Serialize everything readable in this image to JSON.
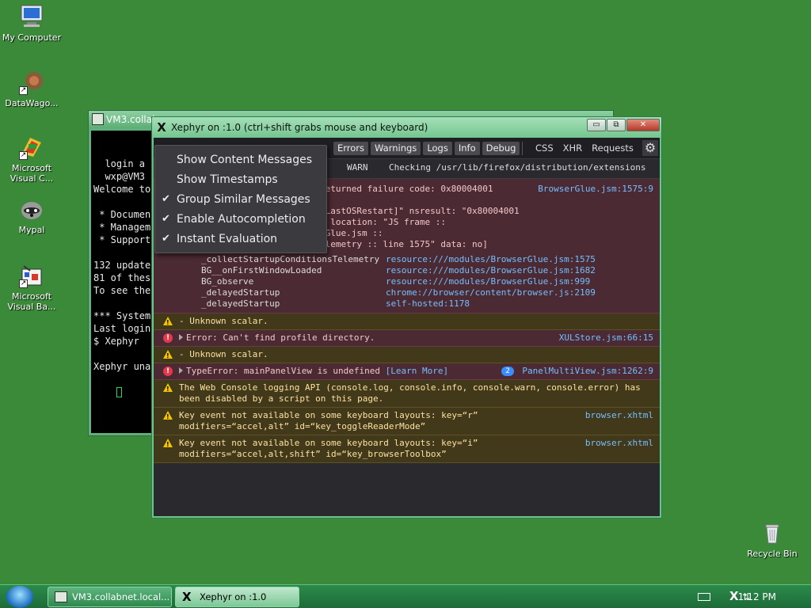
{
  "desktop": {
    "icons": [
      {
        "label_line1": "My Computer",
        "label_line2": ""
      },
      {
        "label_line1": "DataWago...",
        "label_line2": ""
      },
      {
        "label_line1": "Microsoft",
        "label_line2": "Visual C..."
      },
      {
        "label_line1": "Mypal",
        "label_line2": ""
      },
      {
        "label_line1": "Microsoft",
        "label_line2": "Visual Ba..."
      },
      {
        "label_line1": "Recycle Bin",
        "label_line2": ""
      }
    ]
  },
  "terminal": {
    "title": "VM3.collab",
    "lines": [
      "  login a",
      "  wxp@VM3",
      "Welcome to",
      "",
      " * Documen",
      " * Managem",
      " * Support",
      "",
      "132 update",
      "81 of thes",
      "To see the",
      "",
      "*** System",
      "Last login",
      "$ Xephyr",
      "",
      "Xephyr una"
    ]
  },
  "xephyr": {
    "title": "Xephyr on :1.0 (ctrl+shift grabs mouse and keyboard)",
    "window_buttons": {
      "minimize": "▭",
      "maximize": "⧉",
      "close": "✕"
    }
  },
  "console": {
    "filters": [
      "Errors",
      "Warnings",
      "Logs",
      "Info",
      "Debug"
    ],
    "net_filters": [
      "CSS",
      "XHR",
      "Requests"
    ],
    "first_log": {
      "level": "WARN",
      "text": "Checking /usr/lib/firefox/distribution/extensions"
    },
    "error_block": {
      "line1": "returned failure code: 0x80004001",
      "line1_src": "BrowserGlue.jsm:1575:9",
      "line2": "eLastOSRestart]\"  nsresult: \"0x80004001",
      "line3": "\"  location: \"JS frame ::",
      "line4": "rGlue.jsm ::",
      "line5": "elemetry :: line 1575\"  data: no]",
      "stack": [
        {
          "fn": "_collectStartupConditionsTelemetry",
          "src": "resource:///modules/BrowserGlue.jsm:1575"
        },
        {
          "fn": "BG__onFirstWindowLoaded",
          "src": "resource:///modules/BrowserGlue.jsm:1682"
        },
        {
          "fn": "BG_observe",
          "src": "resource:///modules/BrowserGlue.jsm:999"
        },
        {
          "fn": "_delayedStartup",
          "src": "chrome://browser/content/browser.js:2109"
        },
        {
          "fn": "_delayedStartup",
          "src": "self-hosted:1178"
        }
      ]
    },
    "messages": [
      {
        "type": "warn",
        "text": "- Unknown scalar.",
        "text2": "",
        "src": ""
      },
      {
        "type": "error",
        "text": "Error: Can't find profile directory.",
        "text2": "",
        "src": "XULStore.jsm:66:15"
      },
      {
        "type": "warn",
        "text": "- Unknown scalar.",
        "text2": "",
        "src": ""
      },
      {
        "type": "error",
        "text": "TypeError: mainPanelView is undefined",
        "learn": "[Learn More]",
        "badge": "2",
        "src": "PanelMultiView.jsm:1262:9"
      },
      {
        "type": "warn",
        "text": "The Web Console logging API (console.log, console.info, console.warn, console.error) has",
        "text2": "been disabled by a script on this page.",
        "src": ""
      },
      {
        "type": "warn",
        "text": "Key event not available on some keyboard layouts: key=“r”",
        "text2": "modifiers=“accel,alt” id=“key_toggleReaderMode”",
        "src": "browser.xhtml"
      },
      {
        "type": "warn",
        "text": "Key event not available on some keyboard layouts: key=“i”",
        "text2": "modifiers=“accel,alt,shift” id=“key_browserToolbox”",
        "src": "browser.xhtml"
      }
    ]
  },
  "menu": {
    "items": [
      {
        "label": "Show Content Messages",
        "checked": false
      },
      {
        "label": "Show Timestamps",
        "checked": false
      },
      {
        "label": "Group Similar Messages",
        "checked": true
      },
      {
        "label": "Enable Autocompletion",
        "checked": true
      },
      {
        "label": "Instant Evaluation",
        "checked": true
      }
    ],
    "check_glyph": "✔"
  },
  "taskbar": {
    "tasks": [
      "VM3.collabnet.local...",
      "Xephyr on :1.0 [ctrl+..."
    ],
    "clock": "1:12 PM"
  }
}
